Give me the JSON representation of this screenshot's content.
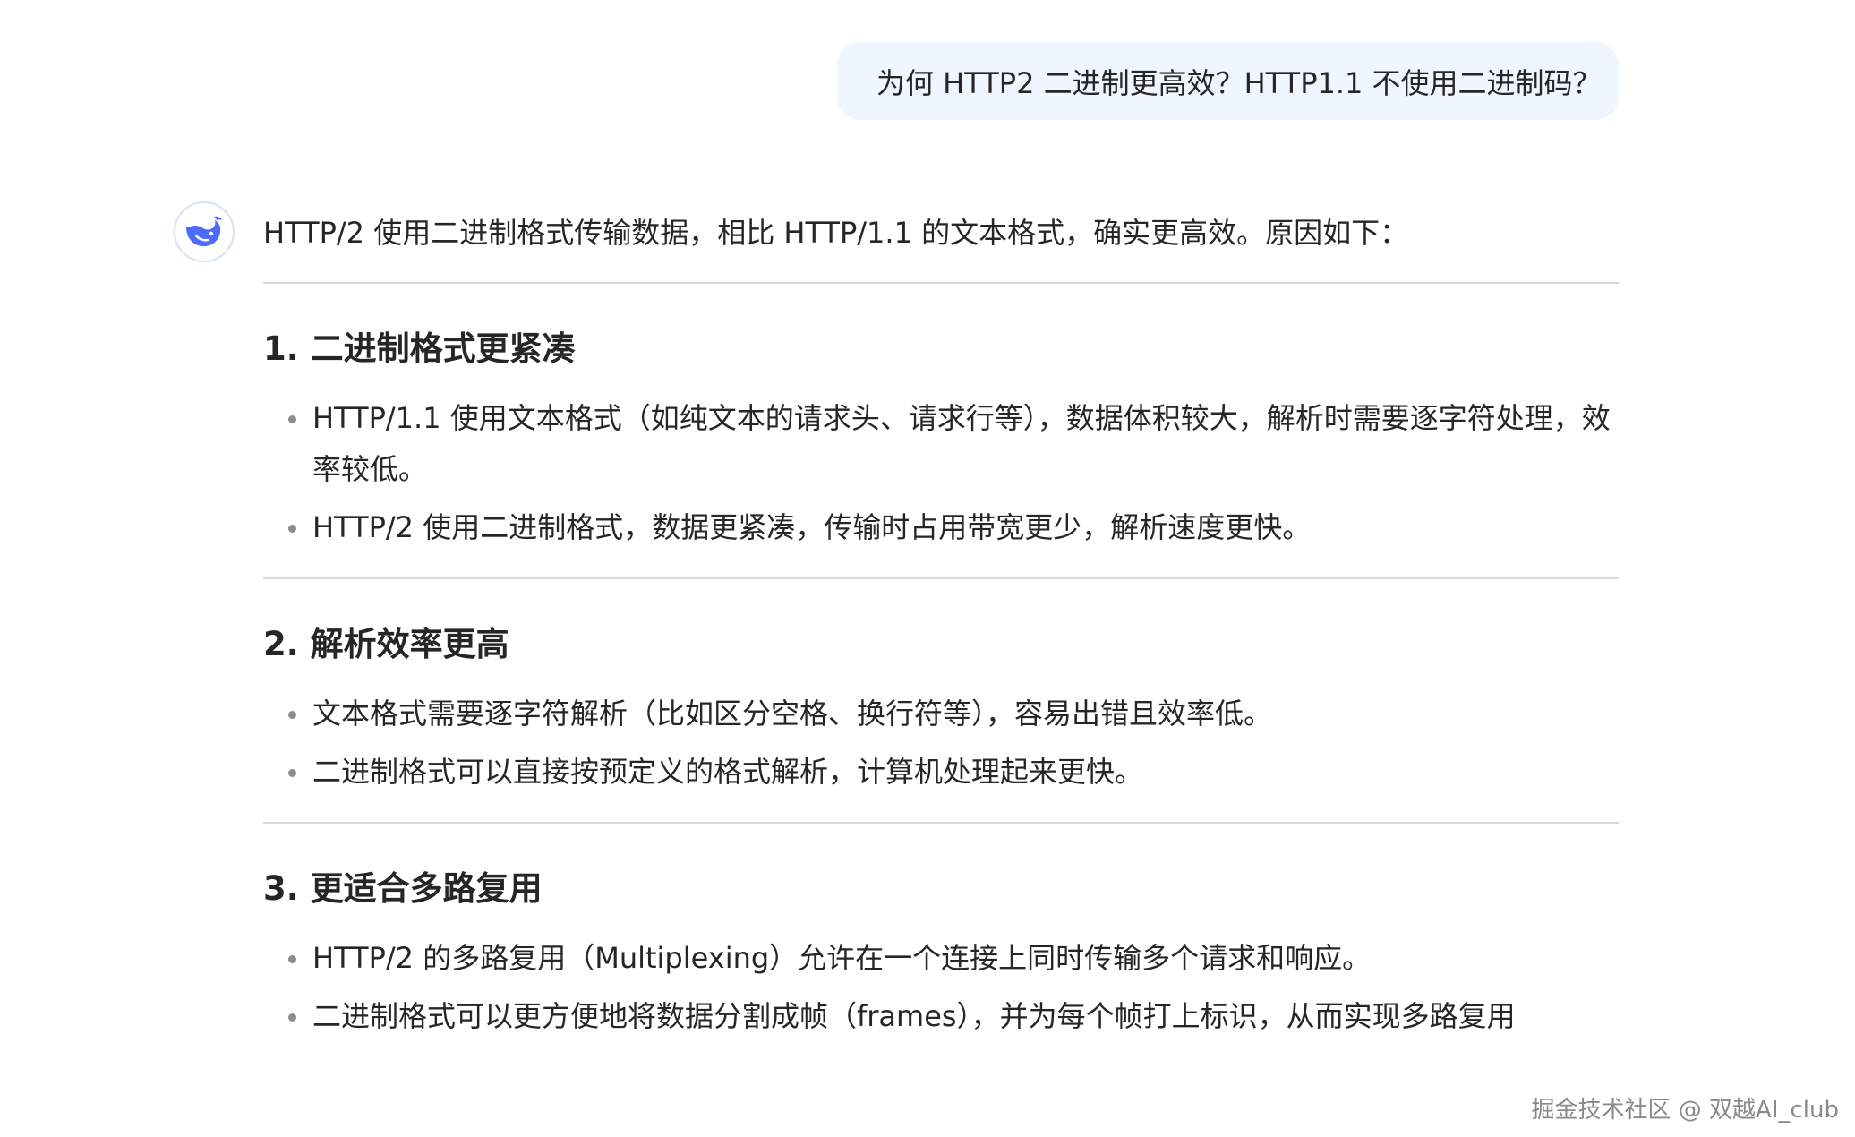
{
  "user_message": "为何 HTTP2 二进制更高效？HTTP1.1 不使用二进制码？",
  "assistant": {
    "avatar_icon": "deepseek-whale-icon",
    "intro": "HTTP/2 使用二进制格式传输数据，相比 HTTP/1.1 的文本格式，确实更高效。原因如下：",
    "sections": [
      {
        "title": "1. 二进制格式更紧凑",
        "bullets": [
          "HTTP/1.1 使用文本格式（如纯文本的请求头、请求行等），数据体积较大，解析时需要逐字符处理，效率较低。",
          "HTTP/2 使用二进制格式，数据更紧凑，传输时占用带宽更少，解析速度更快。"
        ]
      },
      {
        "title": "2. 解析效率更高",
        "bullets": [
          "文本格式需要逐字符解析（比如区分空格、换行符等），容易出错且效率低。",
          "二进制格式可以直接按预定义的格式解析，计算机处理起来更快。"
        ]
      },
      {
        "title": "3. 更适合多路复用",
        "bullets": [
          "HTTP/2 的多路复用（Multiplexing）允许在一个连接上同时传输多个请求和响应。",
          "二进制格式可以更方便地将数据分割成帧（frames），并为每个帧打上标识，从而实现多路复用"
        ]
      }
    ]
  },
  "watermark": "掘金技术社区 @ 双越AI_club",
  "colors": {
    "user_bubble_bg": "#eff6ff",
    "avatar_blue": "#4d6bfe",
    "text": "#262626",
    "bullet_dot": "#8c8c8c",
    "divider": "#d9d9d9"
  }
}
